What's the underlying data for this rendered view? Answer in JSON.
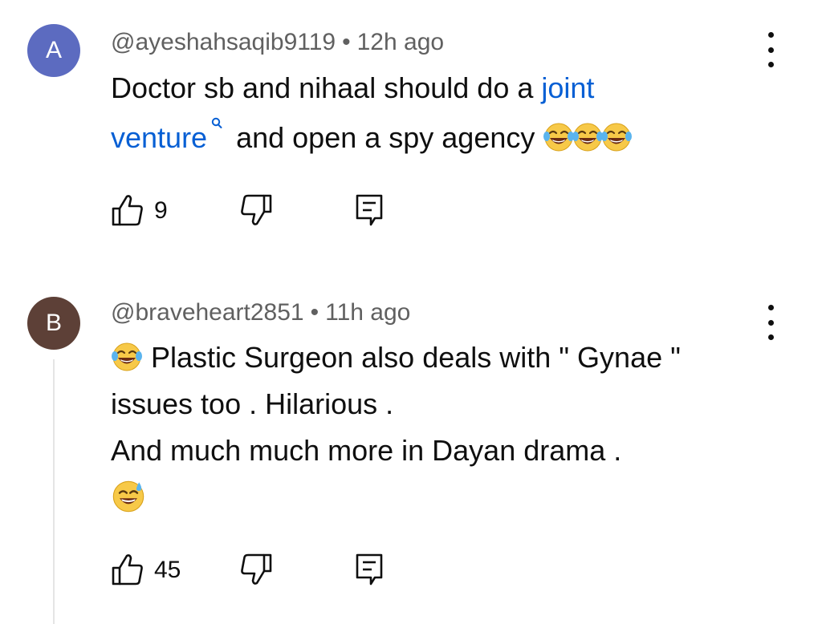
{
  "comments": [
    {
      "avatar_letter": "A",
      "avatar_color": "#5c6bc0",
      "author": "@ayeshahsaqib9119",
      "separator": "•",
      "time": "12h ago",
      "text": {
        "part1": "Doctor sb and nihaal should do a ",
        "link_word1": "joint",
        "link_word2": "venture",
        "part2": " and open a spy agency "
      },
      "emojis": [
        "face-with-tears-of-joy",
        "face-with-tears-of-joy",
        "face-with-tears-of-joy"
      ],
      "likes": "9",
      "icons": {
        "like": "thumbs-up-icon",
        "dislike": "thumbs-down-icon",
        "reply": "reply-icon",
        "menu": "more-vertical-icon"
      }
    },
    {
      "avatar_letter": "B",
      "avatar_color": "#5d4037",
      "author": "@braveheart2851",
      "separator": "•",
      "time": "11h ago",
      "text": {
        "line1": " Plastic Surgeon also deals with  \" Gynae \"",
        "line2": "issues too . Hilarious .",
        "line3": "And much much more in Dayan drama ."
      },
      "emojis": [
        "face-with-tears-of-joy",
        "grinning-face-with-sweat"
      ],
      "likes": "45",
      "icons": {
        "like": "thumbs-up-icon",
        "dislike": "thumbs-down-icon",
        "reply": "reply-icon",
        "menu": "more-vertical-icon"
      }
    }
  ],
  "colors": {
    "link": "#065fd4",
    "meta": "#606060",
    "text": "#0f0f0f"
  }
}
